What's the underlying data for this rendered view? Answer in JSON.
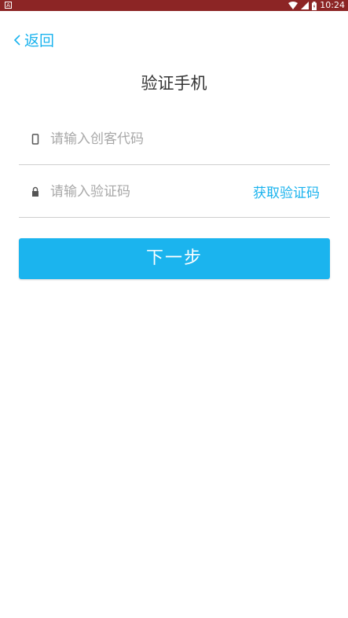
{
  "status_bar": {
    "app_badge": "A",
    "time": "10:24",
    "icons": [
      "wifi-icon",
      "signal-icon",
      "battery-icon"
    ]
  },
  "nav": {
    "back_label": "返回"
  },
  "page": {
    "title": "验证手机"
  },
  "form": {
    "code_field": {
      "placeholder": "请输入创客代码",
      "value": "",
      "icon": "phone-icon"
    },
    "verify_field": {
      "placeholder": "请输入验证码",
      "value": "",
      "icon": "lock-icon"
    },
    "get_code_label": "获取验证码",
    "next_label": "下一步"
  },
  "colors": {
    "status_bar": "#8c2525",
    "accent": "#1ab3ee",
    "button": "#1bb4ee",
    "divider": "#cfcfcf"
  }
}
